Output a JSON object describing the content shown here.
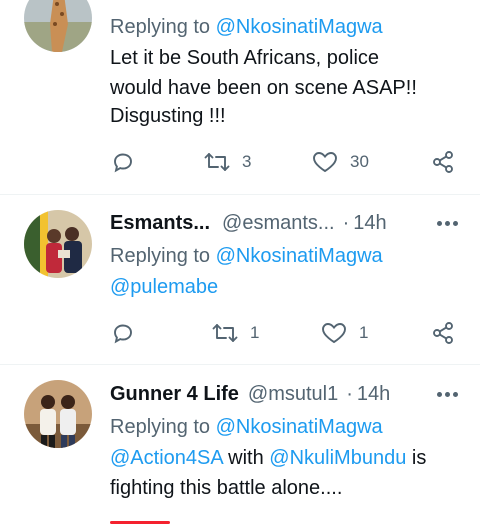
{
  "tweets": [
    {
      "replying_prefix": "Replying to",
      "replying_to": "@NkosinatiMagwa",
      "lines": [
        "Let it be South Africans, police",
        "would have been on scene ASAP!!",
        "Disgusting !!!"
      ],
      "actions": {
        "reply": "",
        "retweet": "3",
        "like": "30"
      }
    },
    {
      "display_name": "Esmants...",
      "handle": "@esmants...",
      "dot": "·",
      "time": "14h",
      "replying_prefix": "Replying to",
      "replying_to": "@NkosinatiMagwa",
      "extra_mention": "@pulemabe",
      "actions": {
        "reply": "",
        "retweet": "1",
        "like": "1"
      }
    },
    {
      "display_name": "Gunner 4 Life",
      "handle": "@msutul1",
      "dot": "·",
      "time": "14h",
      "replying_prefix": "Replying to",
      "replying_to": "@NkosinatiMagwa",
      "line2_mention1": "@Action4SA",
      "line2_with": " with ",
      "line2_mention2": "@NkuliMbundu",
      "line2_tail": " is",
      "line3": "fighting this battle alone...."
    }
  ],
  "colors": {
    "link": "#1d9bf0",
    "secondary": "#536471",
    "text": "#0f1419",
    "divider": "#eff3f4"
  },
  "icons": [
    "reply-icon",
    "retweet-icon",
    "like-icon",
    "share-icon",
    "more-icon"
  ]
}
